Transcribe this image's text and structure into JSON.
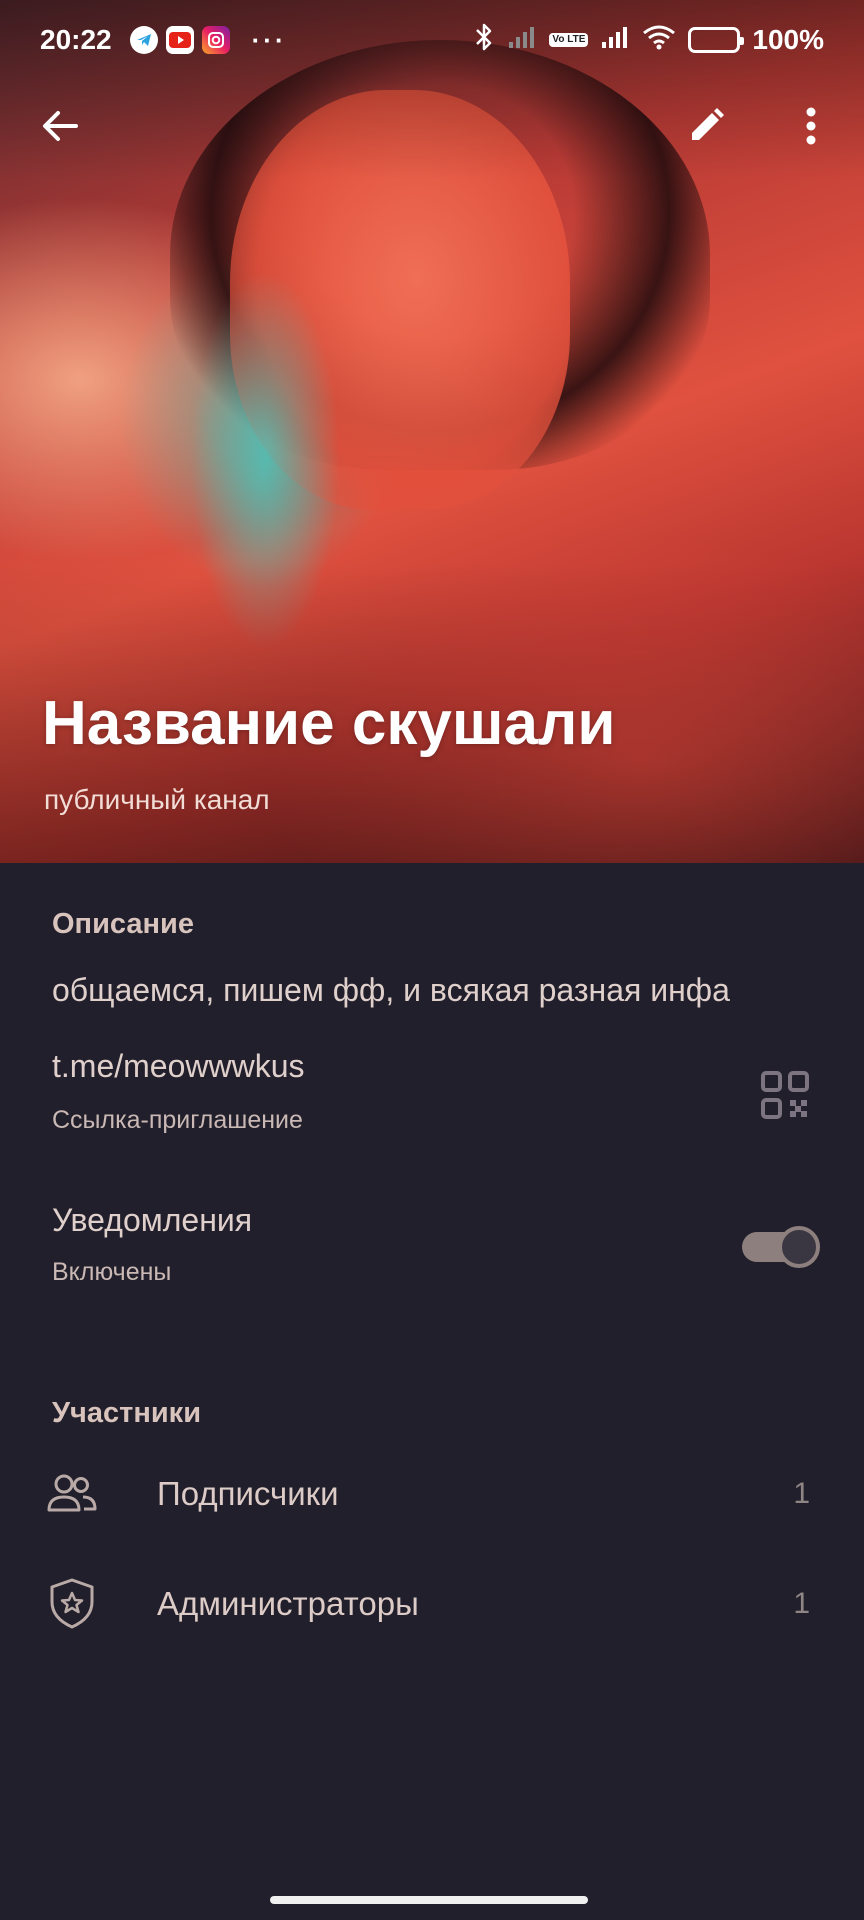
{
  "status_bar": {
    "time": "20:22",
    "apps": [
      "telegram-icon",
      "youtube-icon",
      "instagram-icon"
    ],
    "more": "···",
    "battery": "100%",
    "volte": "Vo LTE"
  },
  "header": {
    "title": "Название скушали",
    "subtitle": "публичный канал"
  },
  "info": {
    "description_header": "Описание",
    "description_text": "общаемся, пишем фф, и всякая разная инфа",
    "link": "t.me/meowwwkus",
    "link_caption": "Ссылка-приглашение",
    "notifications_label": "Уведомления",
    "notifications_state": "Включены",
    "notifications_enabled": true
  },
  "members": {
    "header": "Участники",
    "items": [
      {
        "label": "Подписчики",
        "count": "1",
        "icon": "people-icon"
      },
      {
        "label": "Администраторы",
        "count": "1",
        "icon": "admin-shield-icon"
      }
    ]
  },
  "colors": {
    "background": "#211f2b",
    "accent_photo": "#e0513f"
  }
}
